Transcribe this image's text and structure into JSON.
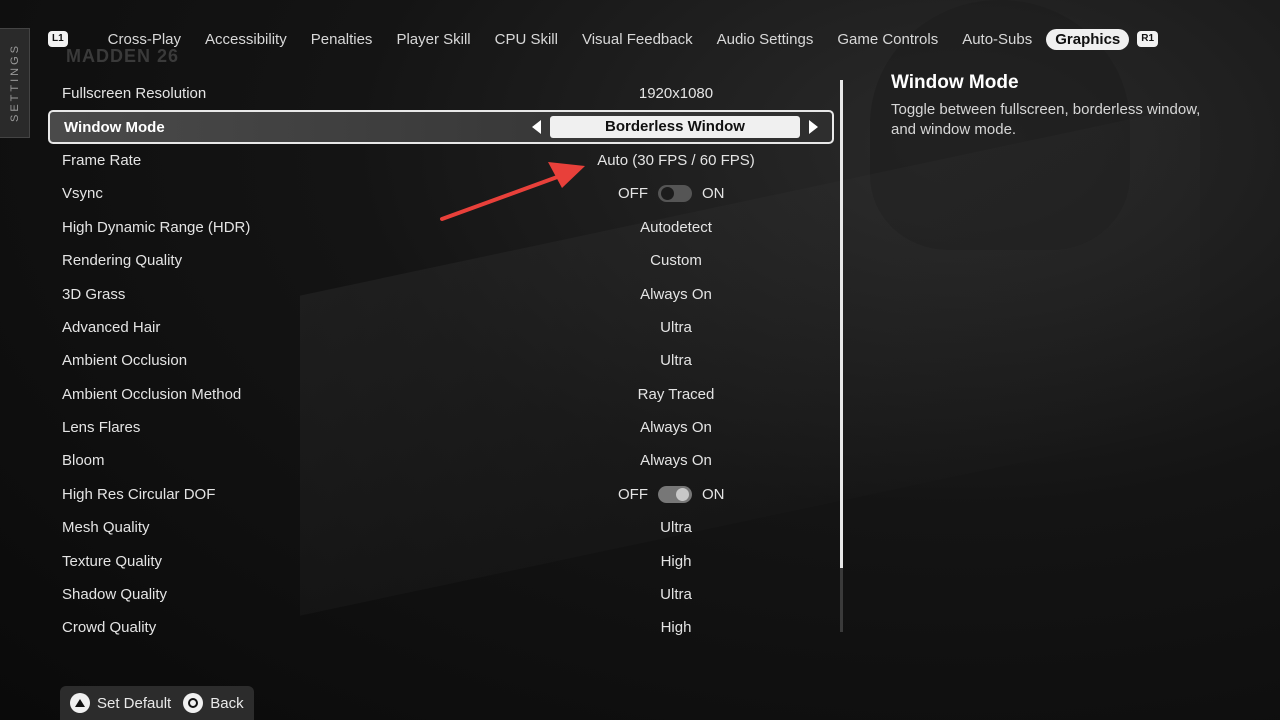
{
  "side_tab": "SETTINGS",
  "logo": "MADDEN 26",
  "nav": {
    "left_badge": "L1",
    "right_badge": "R1",
    "tabs": [
      {
        "label": "Cross-Play",
        "active": false
      },
      {
        "label": "Accessibility",
        "active": false
      },
      {
        "label": "Penalties",
        "active": false
      },
      {
        "label": "Player Skill",
        "active": false
      },
      {
        "label": "CPU Skill",
        "active": false
      },
      {
        "label": "Visual Feedback",
        "active": false
      },
      {
        "label": "Audio Settings",
        "active": false
      },
      {
        "label": "Game Controls",
        "active": false
      },
      {
        "label": "Auto-Subs",
        "active": false
      },
      {
        "label": "Graphics",
        "active": true
      }
    ]
  },
  "settings": [
    {
      "label": "Fullscreen Resolution",
      "value": "1920x1080"
    },
    {
      "label": "Window Mode",
      "value": "Borderless Window",
      "selected": true
    },
    {
      "label": "Frame Rate",
      "value": "Auto (30 FPS / 60 FPS)"
    },
    {
      "label": "Vsync",
      "toggle": {
        "off": "OFF",
        "on": "ON",
        "state": "off"
      }
    },
    {
      "label": "High Dynamic Range (HDR)",
      "value": "Autodetect"
    },
    {
      "label": "Rendering Quality",
      "value": "Custom"
    },
    {
      "label": "3D Grass",
      "value": "Always On"
    },
    {
      "label": "Advanced Hair",
      "value": "Ultra"
    },
    {
      "label": "Ambient Occlusion",
      "value": "Ultra"
    },
    {
      "label": "Ambient Occlusion Method",
      "value": "Ray Traced"
    },
    {
      "label": "Lens Flares",
      "value": "Always On"
    },
    {
      "label": "Bloom",
      "value": "Always On"
    },
    {
      "label": "High Res Circular DOF",
      "toggle": {
        "off": "OFF",
        "on": "ON",
        "state": "on"
      }
    },
    {
      "label": "Mesh Quality",
      "value": "Ultra"
    },
    {
      "label": "Texture Quality",
      "value": "High"
    },
    {
      "label": "Shadow Quality",
      "value": "Ultra"
    },
    {
      "label": "Crowd Quality",
      "value": "High"
    }
  ],
  "description": {
    "title": "Window Mode",
    "text": "Toggle between fullscreen, borderless window, and window mode."
  },
  "footer": {
    "set_default": "Set Default",
    "back": "Back"
  },
  "colors": {
    "annotation_arrow": "#e8403a",
    "highlight": "#f0f0f0"
  },
  "icons": [
    "triangle-button-icon",
    "circle-button-icon",
    "left-arrow-icon",
    "right-arrow-icon"
  ]
}
